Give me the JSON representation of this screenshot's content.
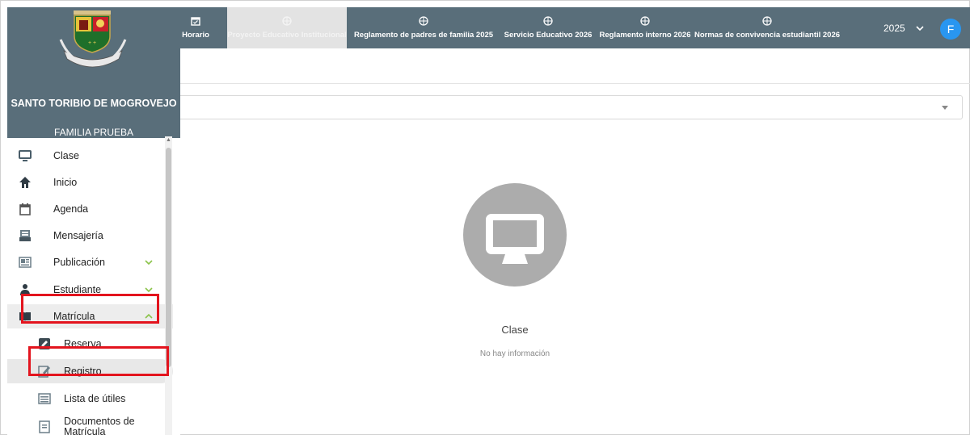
{
  "school": {
    "name": "SANTO TORIBIO DE MOGROVEJO",
    "family": "FAMILIA PRUEBA"
  },
  "topbar": {
    "tabs": [
      {
        "label": "Horario",
        "icon": "calendar-icon"
      },
      {
        "label": "Proyecto Educativo Institucional",
        "icon": "globe-icon",
        "active": true
      },
      {
        "label": "Reglamento de padres de familia 2025",
        "icon": "globe-icon"
      },
      {
        "label": "Servicio Educativo 2026",
        "icon": "globe-icon"
      },
      {
        "label": "Reglamento interno 2026",
        "icon": "globe-icon"
      },
      {
        "label": "Normas de convivencia estudiantil 2026",
        "icon": "globe-icon"
      }
    ],
    "year": "2025",
    "avatar_initial": "F"
  },
  "sidebar": {
    "items": [
      {
        "label": "Clase",
        "icon": "monitor-icon"
      },
      {
        "label": "Inicio",
        "icon": "home-icon"
      },
      {
        "label": "Agenda",
        "icon": "calendar-icon"
      },
      {
        "label": "Mensajería",
        "icon": "message-icon"
      },
      {
        "label": "Publicación",
        "icon": "newspaper-icon",
        "expandable": true
      },
      {
        "label": "Estudiante",
        "icon": "student-icon",
        "expandable": true
      },
      {
        "label": "Matrícula",
        "icon": "book-icon",
        "expanded": true
      }
    ],
    "subitems": [
      {
        "label": "Reserva",
        "icon": "edit-icon"
      },
      {
        "label": "Registro",
        "icon": "register-icon",
        "selected": true
      },
      {
        "label": "Lista de útiles",
        "icon": "list-icon"
      },
      {
        "label": "Documentos de Matrícula",
        "icon": "document-icon"
      }
    ]
  },
  "main": {
    "empty_title": "Clase",
    "empty_message": "No hay información"
  },
  "colors": {
    "header": "#596e7a",
    "highlight": "#e3141e",
    "avatar": "#2996f0",
    "empty_icon": "#acacac"
  }
}
